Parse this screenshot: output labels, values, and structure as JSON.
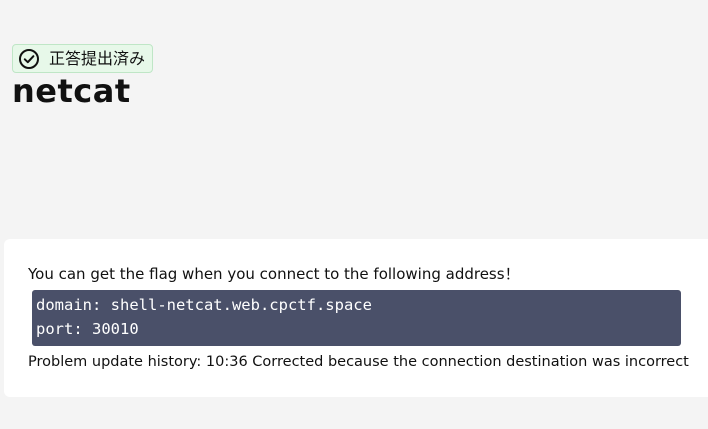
{
  "status_badge": {
    "icon": "check-circle-icon",
    "label": "正答提出済み",
    "colors": {
      "background": "#e7f8e9",
      "border": "#bfe6c6"
    }
  },
  "problem": {
    "title": "netcat",
    "intro": "You can get the flag when you connect to the following address！",
    "code_lines": [
      "domain: shell-netcat.web.cpctf.space",
      "port: 30010"
    ],
    "history": "Problem update history: 10:36 Corrected because the connection destination was incorrect"
  },
  "colors": {
    "page_background": "#f4f4f4",
    "card_background": "#ffffff",
    "code_background": "#4a5069",
    "code_text": "#ffffff"
  }
}
